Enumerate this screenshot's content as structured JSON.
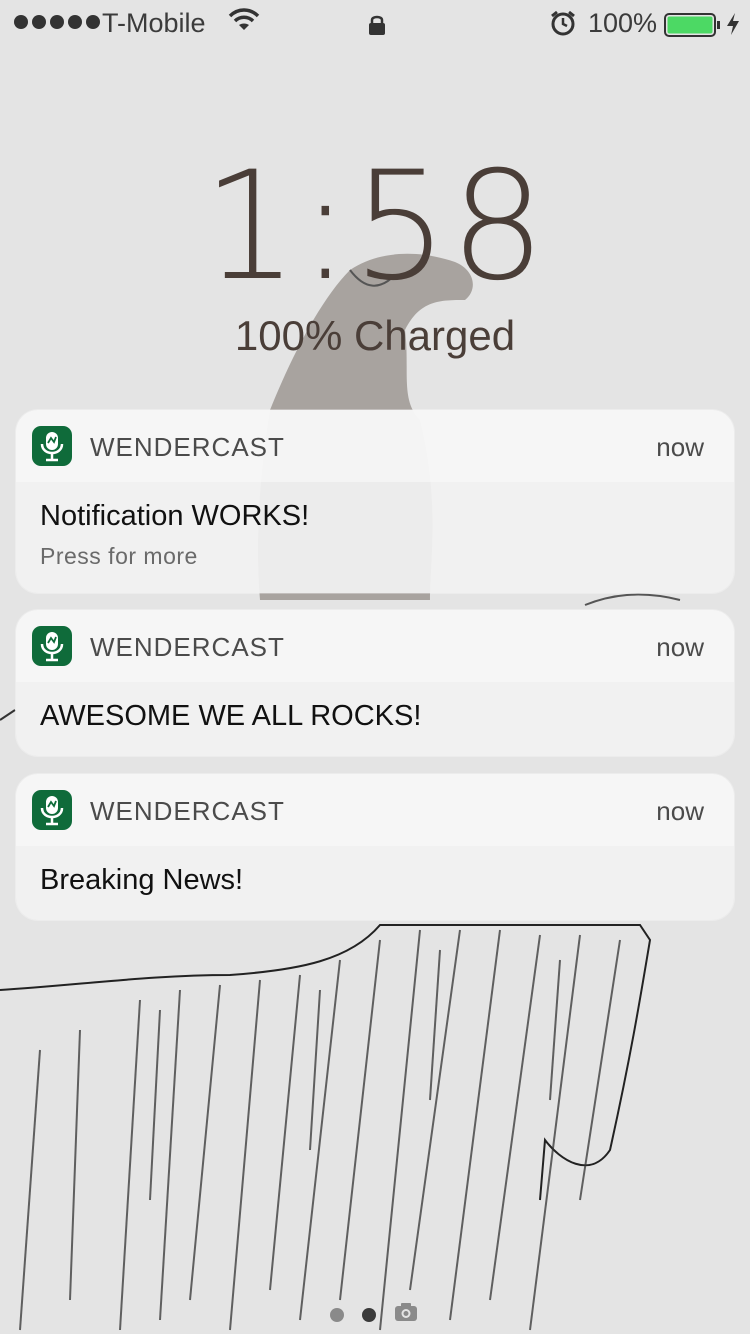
{
  "status_bar": {
    "carrier": "T-Mobile",
    "battery_percent": "100%",
    "battery_level": 1.0,
    "battery_color": "#4cd964"
  },
  "lock_screen": {
    "time": "1:58",
    "charge_status": "100% Charged"
  },
  "notifications": [
    {
      "app": "WENDERCAST",
      "time": "now",
      "title": "Notification WORKS!",
      "subtitle": "Press for more"
    },
    {
      "app": "WENDERCAST",
      "time": "now",
      "title": "AWESOME WE ALL ROCKS!"
    },
    {
      "app": "WENDERCAST",
      "time": "now",
      "title": "Breaking News!"
    }
  ],
  "page_indicator": {
    "pages": 2,
    "current": 2,
    "trailing_icon": "camera-icon"
  },
  "colors": {
    "app_icon": "#0f6b3a",
    "clock_text": "#4a3e38"
  }
}
